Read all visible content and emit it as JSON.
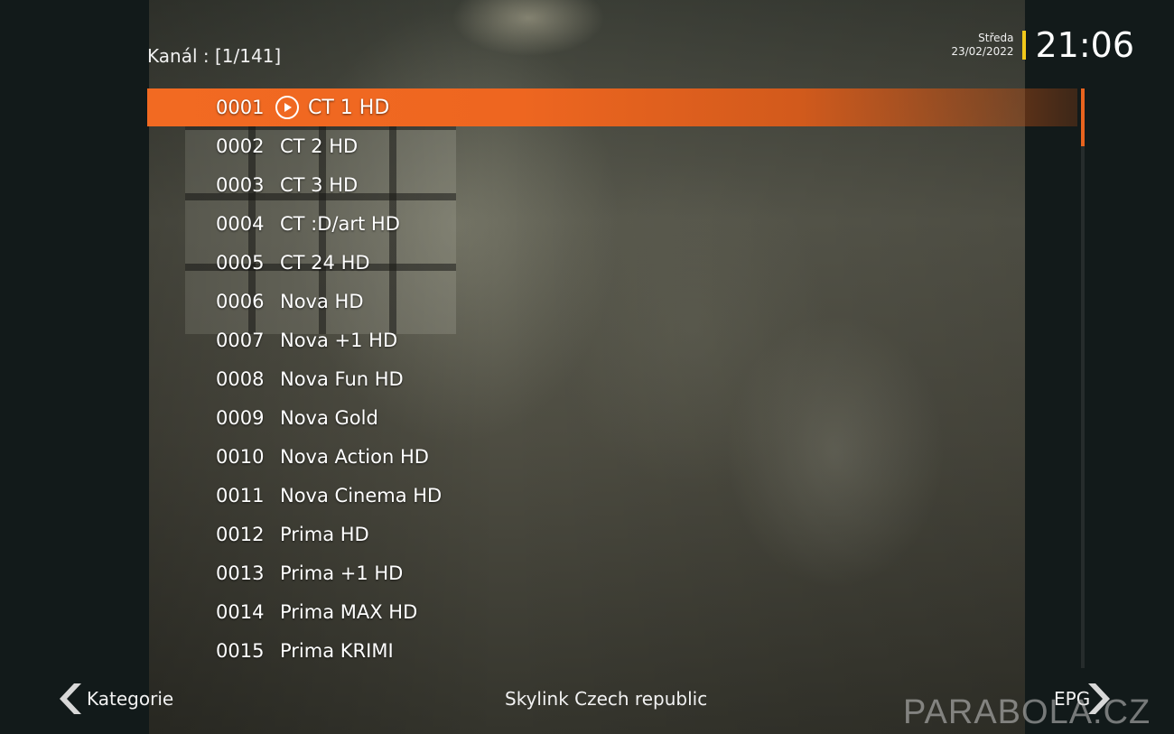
{
  "header": {
    "channel_counter": "Kanál : [1/141]"
  },
  "clock": {
    "day": "Středa",
    "date": "23/02/2022",
    "time": "21:06",
    "accent_color": "#f2c81a"
  },
  "channels": [
    {
      "number": "0001",
      "name": "CT 1 HD",
      "selected": true,
      "icon": "play-circle-icon"
    },
    {
      "number": "0002",
      "name": "CT 2 HD"
    },
    {
      "number": "0003",
      "name": "CT 3 HD"
    },
    {
      "number": "0004",
      "name": "CT :D/art HD"
    },
    {
      "number": "0005",
      "name": "CT 24 HD"
    },
    {
      "number": "0006",
      "name": "Nova HD"
    },
    {
      "number": "0007",
      "name": "Nova +1 HD"
    },
    {
      "number": "0008",
      "name": "Nova Fun HD"
    },
    {
      "number": "0009",
      "name": "Nova Gold"
    },
    {
      "number": "0010",
      "name": "Nova Action HD"
    },
    {
      "number": "0011",
      "name": "Nova Cinema HD"
    },
    {
      "number": "0012",
      "name": "Prima HD"
    },
    {
      "number": "0013",
      "name": "Prima +1 HD"
    },
    {
      "number": "0014",
      "name": "Prima MAX HD"
    },
    {
      "number": "0015",
      "name": "Prima KRIMI"
    }
  ],
  "footer": {
    "left_label": "Kategorie",
    "center_label": "Skylink Czech republic",
    "right_label": "EPG"
  },
  "watermark": "PARABOLA.CZ",
  "colors": {
    "highlight": "#f26a22",
    "scroll_thumb": "#e8631e"
  }
}
